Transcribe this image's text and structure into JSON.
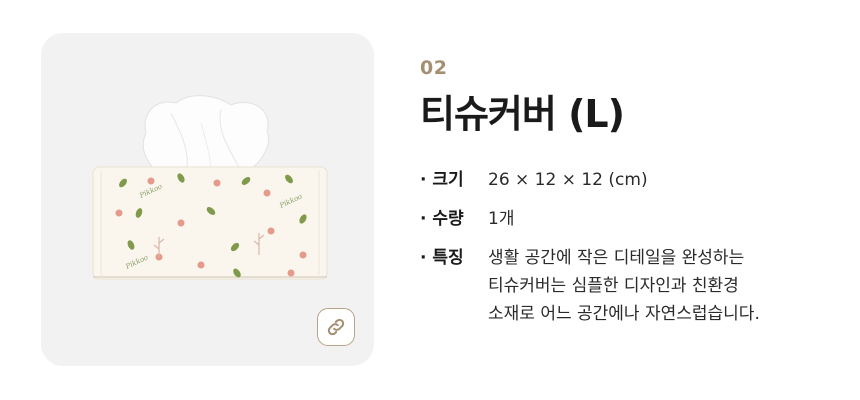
{
  "product": {
    "number": "02",
    "title": "티슈커버 (L)",
    "specs": [
      {
        "label": "· 크기",
        "value_lines": [
          "26 × 12 × 12 (cm)"
        ]
      },
      {
        "label": "· 수량",
        "value_lines": [
          "1개"
        ]
      },
      {
        "label": "· 특징",
        "value_lines": [
          "생활 공간에 작은 디테일을 완성하는",
          "티슈커버는 심플한 디자인과 친환경",
          "소재로 어느 공간에나 자연스럽습니다."
        ]
      }
    ]
  },
  "image": {
    "box_text_1": "Pikkoo",
    "box_text_2": "Pikkoo",
    "box_text_3": "Pikkoo",
    "link_icon": "link-icon"
  },
  "colors": {
    "accent": "#a58f73",
    "card_bg": "#f2f2f2",
    "box": "#faf6ee",
    "leaf_green": "#7f9a4a",
    "flower_pink": "#e59a8a"
  }
}
